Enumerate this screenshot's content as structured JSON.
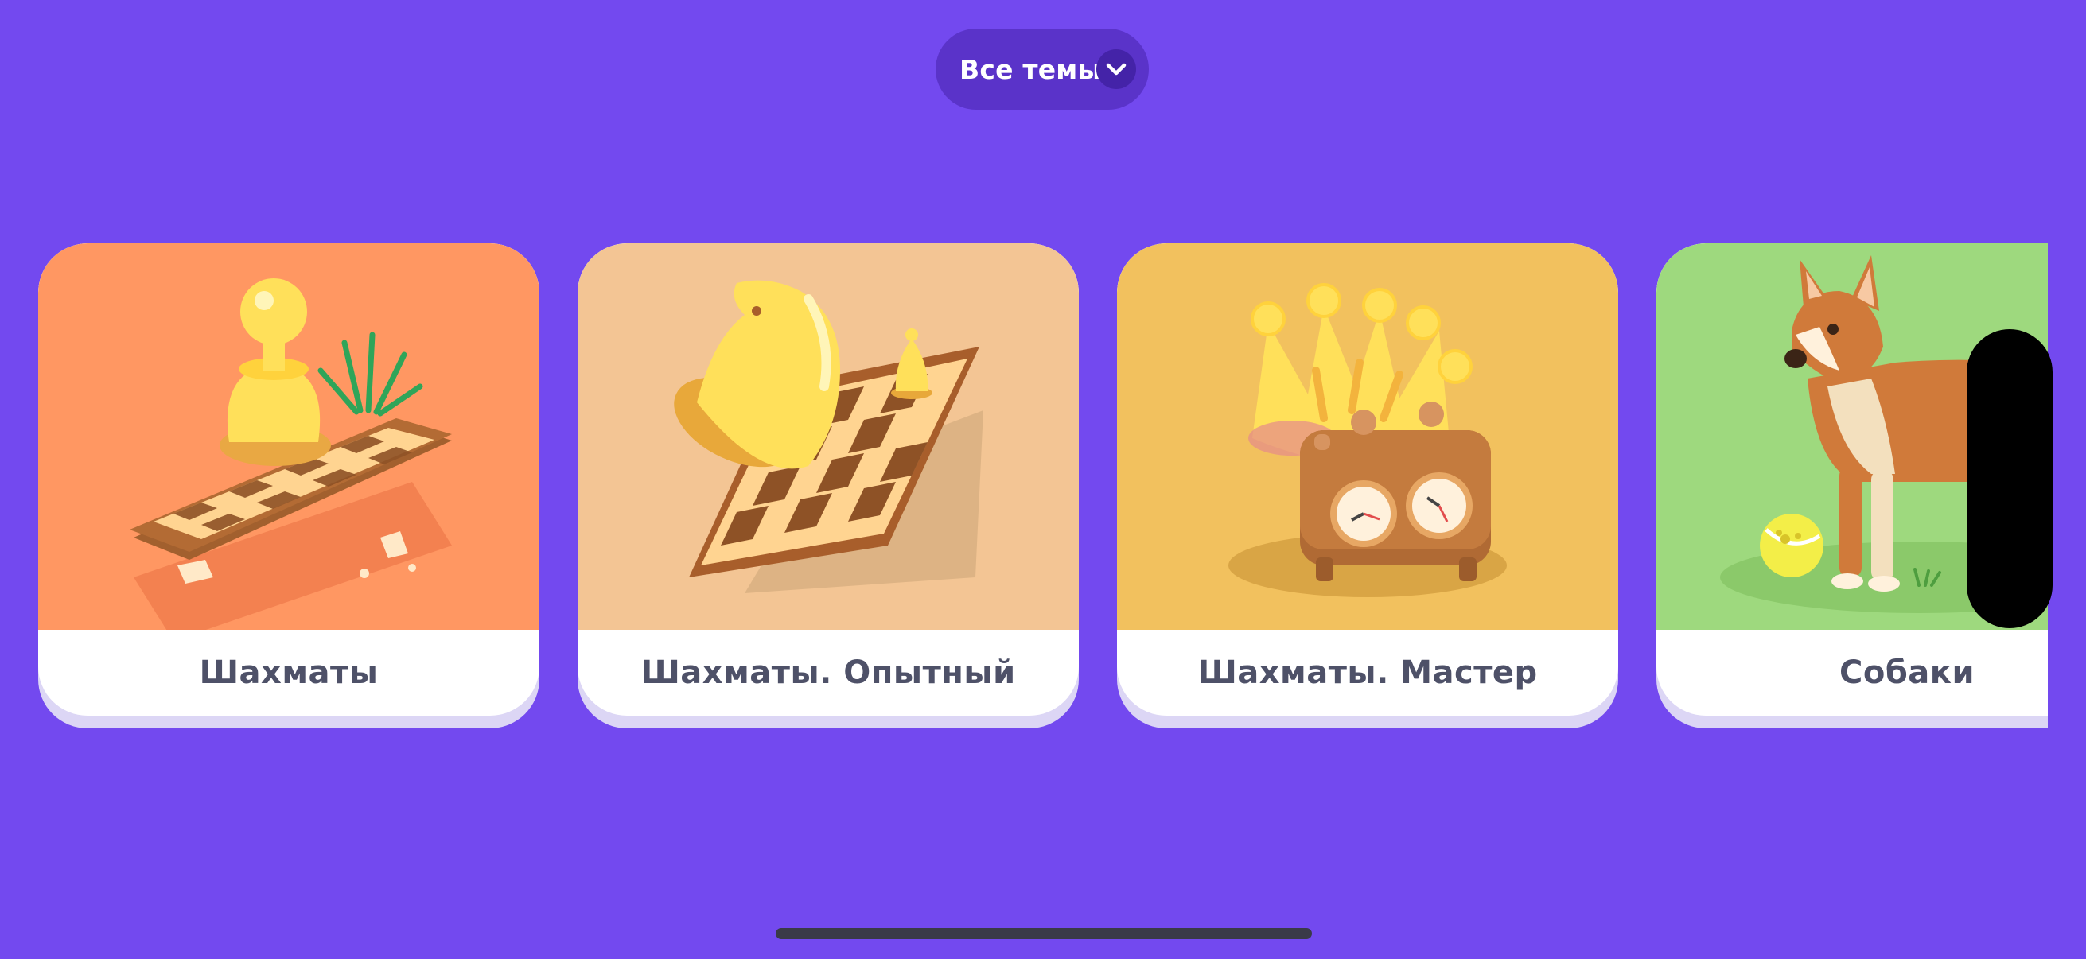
{
  "header": {
    "topic_selector_label": "Все темы",
    "topic_selector_icon": "chevron-down-icon"
  },
  "cards": [
    {
      "title": "Шахматы",
      "background": "#FF9762",
      "illustration": "pawn-on-chessboard"
    },
    {
      "title": "Шахматы. Опытный",
      "background": "#F3C594",
      "illustration": "knight-on-chessboard"
    },
    {
      "title": "Шахматы. Мастер",
      "background": "#F2C15E",
      "illustration": "crown-and-chess-clock"
    },
    {
      "title": "Собаки",
      "background": "#9ED97E",
      "illustration": "dog-with-tennis-ball"
    }
  ],
  "colors": {
    "page_background": "#7349EF",
    "pill_background": "#5A33C9",
    "card_title_text": "#4E5168"
  }
}
